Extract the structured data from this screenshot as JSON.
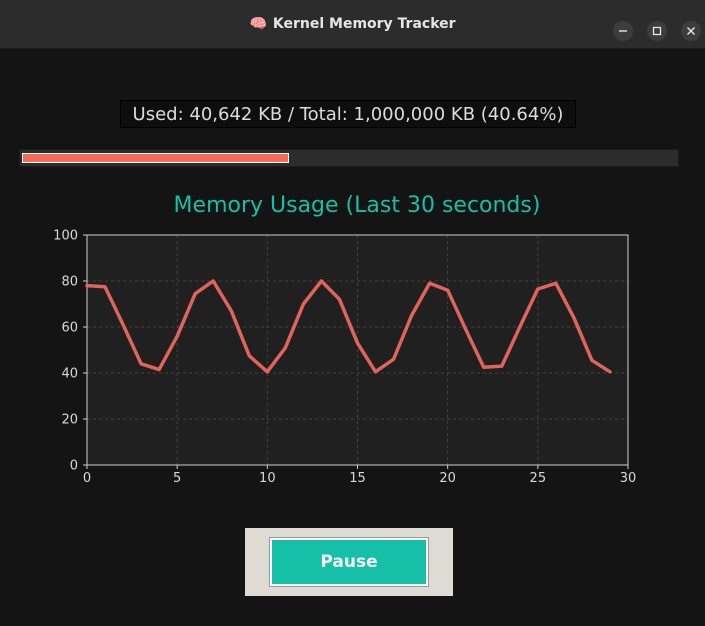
{
  "window": {
    "title": "Kernel Memory Tracker",
    "title_icon": "brain-icon",
    "controls": [
      "minimize-icon",
      "maximize-icon",
      "close-icon"
    ]
  },
  "memory": {
    "label": "Used: 40,642 KB / Total: 1,000,000 KB (40.64%)",
    "used_kb": 40642,
    "total_kb": 1000000,
    "percent": 40.64
  },
  "colors": {
    "accent": "#16bfa7",
    "line": "#e0645a",
    "progress": "#f26b5b",
    "background": "#141414",
    "plot_bg": "#202020"
  },
  "chart_data": {
    "type": "line",
    "title": "Memory Usage (Last 30 seconds)",
    "xlabel": "",
    "ylabel": "",
    "xlim": [
      0,
      30
    ],
    "ylim": [
      0,
      100
    ],
    "xticks": [
      0,
      5,
      10,
      15,
      20,
      25,
      30
    ],
    "yticks": [
      0,
      20,
      40,
      60,
      80,
      100
    ],
    "grid": true,
    "series": [
      {
        "x": [
          0,
          1,
          2,
          3,
          4,
          5,
          6,
          7,
          8,
          9,
          10,
          11,
          12,
          13,
          14,
          15,
          16,
          17,
          18,
          19,
          20,
          21,
          22,
          23,
          24,
          25,
          26,
          27,
          28,
          29
        ],
        "values": [
          78,
          77.5,
          61,
          44,
          41.5,
          56,
          74.5,
          80,
          67,
          47.5,
          40.5,
          51,
          70,
          80,
          72,
          53,
          40.5,
          46,
          65,
          79,
          76,
          59,
          42.5,
          43,
          60,
          76.5,
          79,
          64,
          45.5,
          40.5
        ]
      }
    ]
  },
  "controls": {
    "pause_label": "Pause"
  }
}
